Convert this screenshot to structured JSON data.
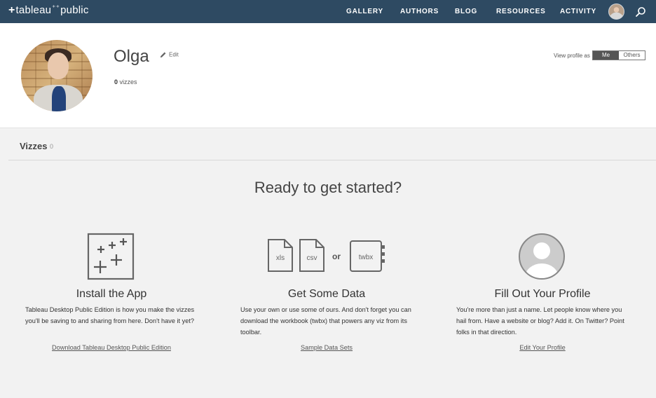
{
  "nav": {
    "logo_text": "tableau",
    "logo_suffix": "public",
    "items": [
      "GALLERY",
      "AUTHORS",
      "BLOG",
      "RESOURCES",
      "ACTIVITY"
    ]
  },
  "profile": {
    "name": "Olga",
    "edit_label": "Edit",
    "viz_count": "0",
    "viz_count_label": "vizzes",
    "view_as_label": "View profile as",
    "view_options": [
      "Me",
      "Others"
    ],
    "selected_view": "Me"
  },
  "vizzes": {
    "title": "Vizzes",
    "count": "0"
  },
  "onboarding": {
    "heading": "Ready to get started?",
    "cards": [
      {
        "title": "Install the App",
        "body": "Tableau Desktop Public Edition is how you make the vizzes you'll be saving to and sharing from here. Don't have it yet?",
        "link": "Download Tableau Desktop Public Edition"
      },
      {
        "title": "Get Some Data",
        "body": "Use your own or use some of ours. And don't forget you can download the workbook (twbx) that powers any viz from its toolbar.",
        "link": "Sample Data Sets",
        "file_labels": [
          "xls",
          "csv",
          "or",
          "twbx"
        ]
      },
      {
        "title": "Fill Out Your Profile",
        "body": "You're more than just a name. Let people know where you hail from. Have a website or blog? Add it. On Twitter? Point folks in that direction.",
        "link": "Edit Your Profile"
      }
    ]
  },
  "colors": {
    "nav_bg": "#2e4a62",
    "page_bg": "#f2f2f2",
    "icon_stroke": "#666666"
  }
}
